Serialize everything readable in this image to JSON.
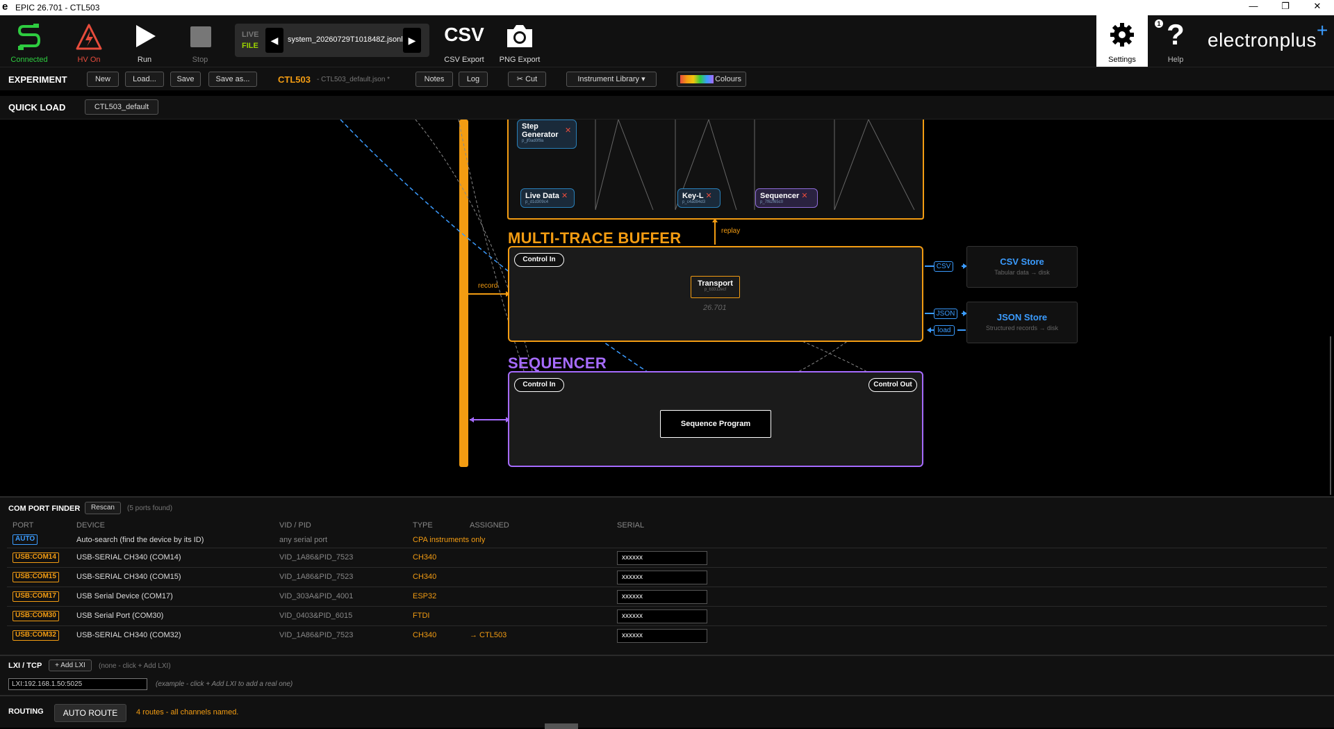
{
  "window": {
    "title": "EPIC 26.701 - CTL503",
    "logo": "e",
    "minimize": "—",
    "restore": "❐",
    "close": "✕"
  },
  "toolbar": {
    "connected_label": "Connected",
    "hv_label": "HV On",
    "run_label": "Run",
    "stop_label": "Stop",
    "live_label": "LIVE",
    "file_label": "FILE",
    "prev_arrow": "◀",
    "next_arrow": "▶",
    "file_name": "system_20260729T101848Z.jsonl",
    "csv_icon_text": "CSV",
    "csv_export_label": "CSV Export",
    "png_export_label": "PNG Export",
    "settings_label": "Settings",
    "help_label": "Help",
    "help_badge": "1",
    "brand_text": "electronplus",
    "brand_plus": "+",
    "colors": {
      "connected": "#2ecc40",
      "hv": "#e74c3c",
      "accent": "#f39c12",
      "blue": "#3b9cff",
      "purple": "#a66bff"
    }
  },
  "experiment": {
    "label": "EXPERIMENT",
    "new": "New",
    "load": "Load...",
    "save": "Save",
    "save_as": "Save as...",
    "name": "CTL503",
    "file": "- CTL503_default.json *",
    "notes": "Notes",
    "log": "Log",
    "cut": "✂ Cut",
    "instrument_library": "Instrument Library ▾",
    "colours": "Colours"
  },
  "quickload": {
    "label": "QUICK LOAD",
    "item": "CTL503_default"
  },
  "canvas": {
    "chips": {
      "step_generator": "Step Generator",
      "step_generator_id": "p_jf0ad0f9a",
      "live_data": "Live Data",
      "live_data_id": "p_d1d309c4",
      "key_l": "Key-L",
      "key_l_id": "p_c4ad94d3",
      "sequencer_chip": "Sequencer",
      "sequencer_chip_id": "p_7f62f65c0",
      "remove": "✕"
    },
    "replay_label": "replay",
    "record_label": "record",
    "mtb_title": "MULTI-TRACE BUFFER",
    "mtb_control_in": "Control In",
    "transport": "Transport",
    "transport_id": "p_b3312ecf",
    "version_watermark": "26.701",
    "csv_tag": "CSV",
    "json_tag": "JSON",
    "load_tag": "load",
    "csv_store_title": "CSV Store",
    "csv_store_sub": "Tabular data → disk",
    "json_store_title": "JSON Store",
    "json_store_sub": "Structured records → disk",
    "seq_title": "SEQUENCER",
    "seq_control_in": "Control In",
    "seq_control_out": "Control Out",
    "sequence_program": "Sequence Program"
  },
  "com_finder": {
    "label": "COM PORT FINDER",
    "rescan": "Rescan",
    "found": "(5 ports found)",
    "headers": {
      "port": "PORT",
      "device": "DEVICE",
      "vid": "VID / PID",
      "type": "TYPE",
      "assigned": "ASSIGNED",
      "serial": "SERIAL"
    },
    "auto_row": {
      "port": "AUTO",
      "device": "Auto-search (find the device by its ID)",
      "vid": "any serial port",
      "type": "CPA instruments only"
    },
    "rows": [
      {
        "port": "USB:COM14",
        "device": "USB-SERIAL CH340 (COM14)",
        "vid": "VID_1A86&PID_7523",
        "type": "CH340",
        "assigned": "",
        "serial": "xxxxxx"
      },
      {
        "port": "USB:COM15",
        "device": "USB-SERIAL CH340 (COM15)",
        "vid": "VID_1A86&PID_7523",
        "type": "CH340",
        "assigned": "",
        "serial": "xxxxxx"
      },
      {
        "port": "USB:COM17",
        "device": "USB Serial Device (COM17)",
        "vid": "VID_303A&PID_4001",
        "type": "ESP32",
        "assigned": "",
        "serial": "xxxxxx"
      },
      {
        "port": "USB:COM30",
        "device": "USB Serial Port (COM30)",
        "vid": "VID_0403&PID_6015",
        "type": "FTDI",
        "assigned": "",
        "serial": "xxxxxx"
      },
      {
        "port": "USB:COM32",
        "device": "USB-SERIAL CH340 (COM32)",
        "vid": "VID_1A86&PID_7523",
        "type": "CH340",
        "assigned": "→ CTL503",
        "serial": "xxxxxx"
      }
    ]
  },
  "lxi": {
    "label": "LXI / TCP",
    "add": "+ Add LXI",
    "none": "(none - click + Add LXI)",
    "input_value": "LXI:192.168.1.50:5025",
    "example": "(example - click + Add LXI to add a real one)"
  },
  "routing": {
    "label": "ROUTING",
    "auto_route": "AUTO ROUTE",
    "status": "4 routes - all channels named."
  }
}
